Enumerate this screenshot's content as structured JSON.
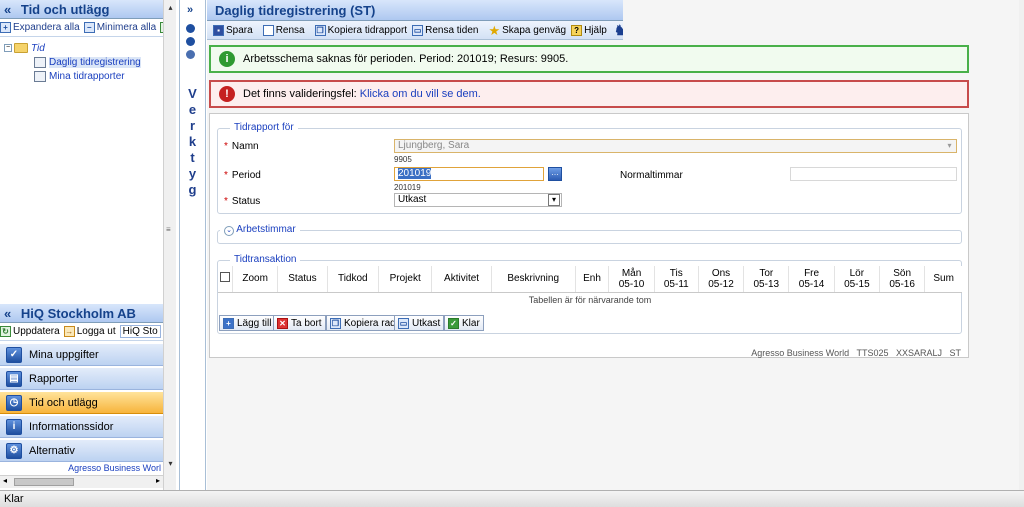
{
  "left_pane": {
    "title": "Tid och utlägg",
    "toolbar": {
      "expand": "Expandera alla",
      "minimize": "Minimera alla"
    },
    "tree": {
      "folder": "Tid",
      "items": [
        "Daglig tidregistrering",
        "Mina tidrapporter"
      ]
    }
  },
  "hiq": {
    "title": "HiQ Stockholm AB",
    "toolbar": {
      "update": "Uppdatera",
      "logout": "Logga ut",
      "tab": "HiQ Sto"
    },
    "nav": [
      "Mina uppgifter",
      "Rapporter",
      "Tid och utlägg",
      "Informationssidor",
      "Alternativ"
    ],
    "active_index": 2,
    "footer": "Agresso Business Worl"
  },
  "toolstrip": {
    "letters": [
      "V",
      "e",
      "r",
      "k",
      "t",
      "y",
      "g"
    ]
  },
  "main": {
    "title": "Daglig tidregistrering (ST)",
    "toolbar": [
      "Spara",
      "Rensa",
      "Kopiera tidrapport",
      "Rensa tiden",
      "Skapa genväg",
      "Hjälp"
    ],
    "messages": {
      "ok": "Arbetsschema saknas för perioden. Period: 201019; Resurs: 9905.",
      "err_text": "Det finns valideringsfel: ",
      "err_link": "Klicka om du vill se dem."
    },
    "form": {
      "group_title": "Tidrapport för",
      "name_label": "Namn",
      "name_value": "Ljungberg, Sara",
      "name_sub": "9905",
      "period_label": "Period",
      "period_value": "201019",
      "period_sub": "201019",
      "status_label": "Status",
      "status_value": "Utkast",
      "normal_label": "Normaltimmar",
      "normal_value": "",
      "hours_group": "Arbetstimmar",
      "trans_group": "Tidtransaktion"
    },
    "grid": {
      "columns": [
        [
          "Zoom",
          ""
        ],
        [
          "Status",
          ""
        ],
        [
          "Tidkod",
          ""
        ],
        [
          "Projekt",
          ""
        ],
        [
          "Aktivitet",
          ""
        ],
        [
          "Beskrivning",
          ""
        ],
        [
          "Enh",
          ""
        ],
        [
          "Mån",
          "05-10"
        ],
        [
          "Tis",
          "05-11"
        ],
        [
          "Ons",
          "05-12"
        ],
        [
          "Tor",
          "05-13"
        ],
        [
          "Fre",
          "05-14"
        ],
        [
          "Lör",
          "05-15"
        ],
        [
          "Sön",
          "05-16"
        ],
        [
          "Sum",
          ""
        ]
      ],
      "empty": "Tabellen är för närvarande tom"
    },
    "grid_buttons": [
      "Lägg till",
      "Ta bort",
      "Kopiera rad",
      "Utkast",
      "Klar"
    ],
    "footer_note": "Agresso Business World   TTS025   XXSARALJ   ST"
  },
  "status_bar": "Klar"
}
